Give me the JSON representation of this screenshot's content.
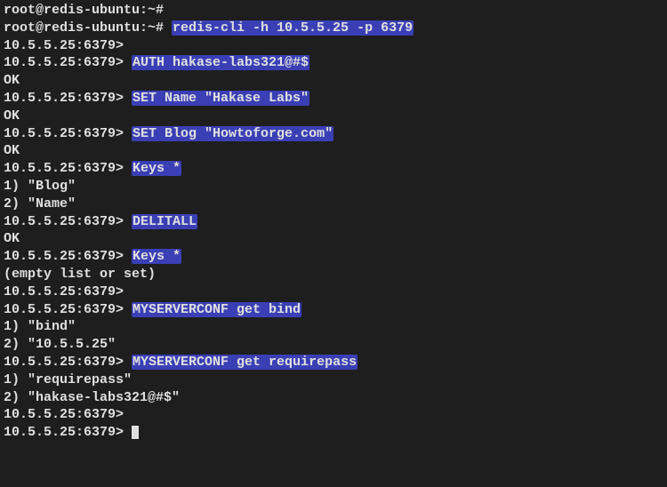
{
  "lines": [
    {
      "prompt": "root@redis-ubuntu:~# ",
      "command": ""
    },
    {
      "prompt": "root@redis-ubuntu:~# ",
      "command": "redis-cli -h 10.5.5.25 -p 6379"
    },
    {
      "prompt": "10.5.5.25:6379> ",
      "command": ""
    },
    {
      "prompt": "10.5.5.25:6379> ",
      "command": "AUTH hakase-labs321@#$"
    },
    {
      "output": "OK"
    },
    {
      "prompt": "10.5.5.25:6379> ",
      "command": "SET Name \"Hakase Labs\""
    },
    {
      "output": "OK"
    },
    {
      "prompt": "10.5.5.25:6379> ",
      "command": "SET Blog \"Howtoforge.com\""
    },
    {
      "output": "OK"
    },
    {
      "prompt": "10.5.5.25:6379> ",
      "command": "Keys *"
    },
    {
      "output": "1) \"Blog\""
    },
    {
      "output": "2) \"Name\""
    },
    {
      "prompt": "10.5.5.25:6379> ",
      "command": "DELITALL"
    },
    {
      "output": "OK"
    },
    {
      "prompt": "10.5.5.25:6379> ",
      "command": "Keys *"
    },
    {
      "output": "(empty list or set)"
    },
    {
      "prompt": "10.5.5.25:6379> ",
      "command": ""
    },
    {
      "prompt": "10.5.5.25:6379> ",
      "command": "MYSERVERCONF get bind"
    },
    {
      "output": "1) \"bind\""
    },
    {
      "output": "2) \"10.5.5.25\""
    },
    {
      "prompt": "10.5.5.25:6379> ",
      "command": "MYSERVERCONF get requirepass"
    },
    {
      "output": "1) \"requirepass\""
    },
    {
      "output": "2) \"hakase-labs321@#$\""
    },
    {
      "prompt": "10.5.5.25:6379> ",
      "command": ""
    },
    {
      "prompt": "10.5.5.25:6379> ",
      "command": "",
      "cursor": true
    }
  ]
}
